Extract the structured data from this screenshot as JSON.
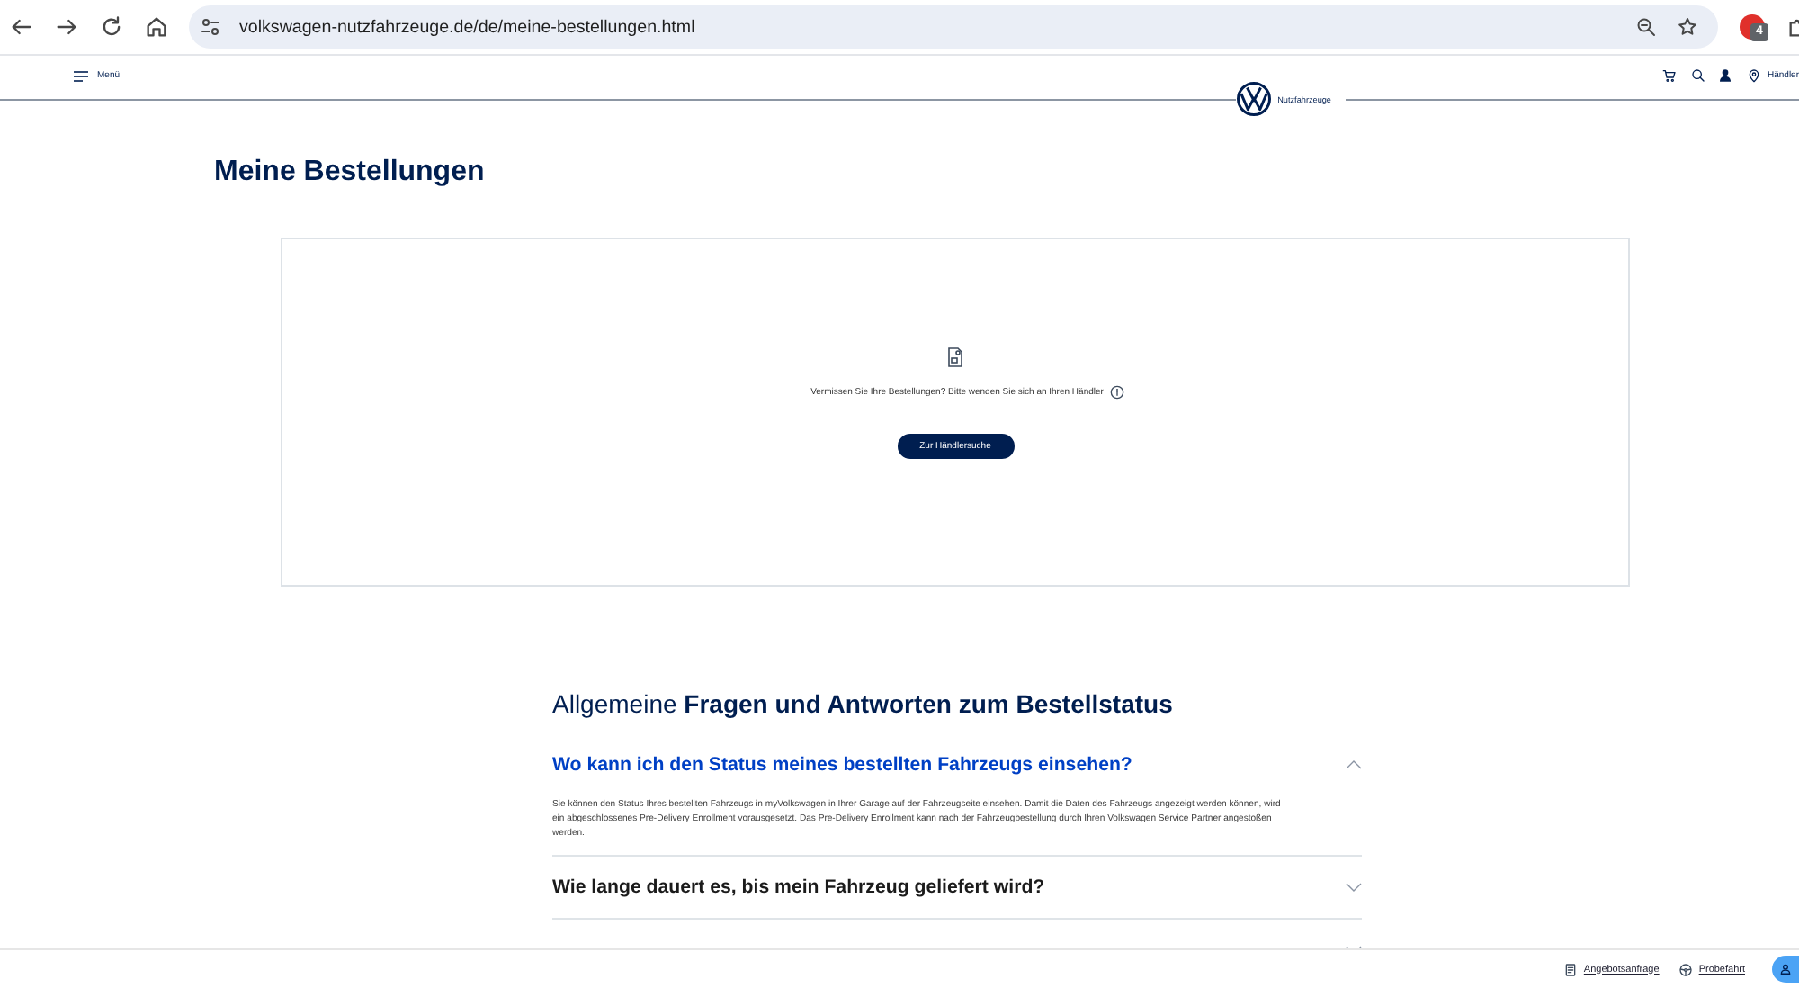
{
  "browser": {
    "url": "volkswagen-nutzfahrzeuge.de/de/meine-bestellungen.html",
    "profile_badge": "4"
  },
  "header": {
    "menu_label": "Menü",
    "brand_label": "Nutzfahrzeuge",
    "dealer_label": "Händler"
  },
  "page": {
    "title": "Meine Bestellungen"
  },
  "orders_panel": {
    "message": "Vermissen Sie Ihre Bestellungen? Bitte wenden Sie sich an Ihren Händler",
    "button": "Zur Händlersuche"
  },
  "faq": {
    "heading": "Allgemeine **Fragen und Antworten zum Bestellstatus**",
    "items": [
      {
        "question": "Wo kann ich den Status meines bestellten Fahrzeugs einsehen?",
        "answer": "Sie können den Status Ihres bestellten Fahrzeugs in myVolkswagen in Ihrer Garage auf der Fahrzeugseite einsehen. Damit die Daten des Fahrzeugs angezeigt werden können, wird ein abgeschlossenes Pre-Delivery Enrollment vorausgesetzt. Das Pre-Delivery Enrollment kann nach der Fahrzeugbestellung durch Ihren Volkswagen Service Partner angestoßen werden.",
        "expanded": true
      },
      {
        "question": "Wie lange dauert es, bis mein Fahrzeug geliefert wird?",
        "expanded": false
      },
      {
        "expanded": false
      }
    ]
  },
  "bottom_bar": {
    "links": [
      {
        "kind": "quote",
        "label": "Angebotsanfrage"
      },
      {
        "kind": "test_drive",
        "label": "Probefahrt"
      }
    ]
  }
}
